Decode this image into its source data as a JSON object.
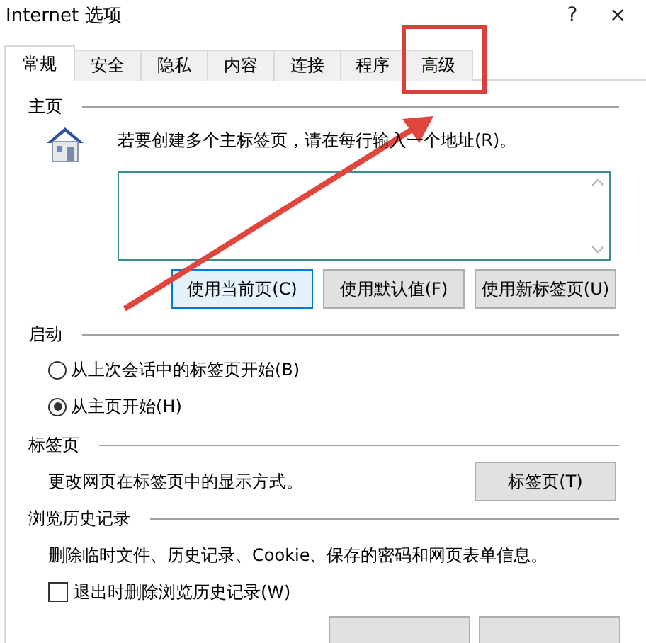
{
  "window": {
    "title": "Internet 选项",
    "help": "?",
    "close": "×"
  },
  "tabs": [
    {
      "label": "常规",
      "selected": true
    },
    {
      "label": "安全",
      "selected": false
    },
    {
      "label": "隐私",
      "selected": false
    },
    {
      "label": "内容",
      "selected": false
    },
    {
      "label": "连接",
      "selected": false
    },
    {
      "label": "程序",
      "selected": false
    },
    {
      "label": "高级",
      "selected": false
    }
  ],
  "homepage": {
    "heading": "主页",
    "hint": "若要创建多个主标签页，请在每行输入一个地址(R)。",
    "buttons": [
      {
        "label": "使用当前页(C)",
        "focused": true
      },
      {
        "label": "使用默认值(F)",
        "focused": false
      },
      {
        "label": "使用新标签页(U)",
        "focused": false
      }
    ]
  },
  "startup": {
    "heading": "启动",
    "options": [
      {
        "label": "从上次会话中的标签页开始(B)",
        "selected": false
      },
      {
        "label": "从主页开始(H)",
        "selected": true
      }
    ]
  },
  "tabs_section": {
    "heading": "标签页",
    "text": "更改网页在标签页中的显示方式。",
    "button": "标签页(T)"
  },
  "history": {
    "heading": "浏览历史记录",
    "text": "删除临时文件、历史记录、Cookie、保存的密码和网页表单信息。",
    "checkbox": {
      "label": "退出时删除浏览历史记录(W)",
      "checked": false
    }
  }
}
